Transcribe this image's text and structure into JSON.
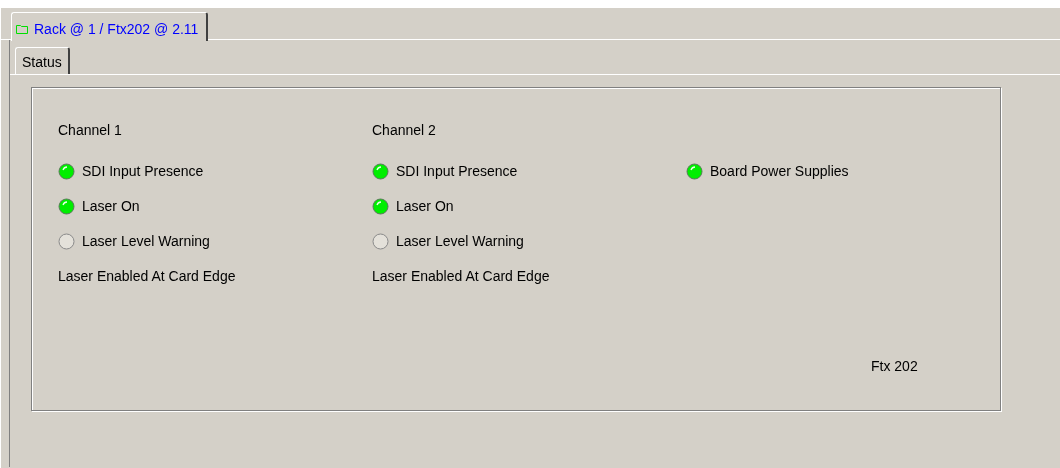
{
  "document_tabs": [
    {
      "label": "Rack @ 1 / Ftx202 @ 2.11",
      "selected": true
    }
  ],
  "page_tabs": [
    {
      "label": "Status",
      "selected": true
    }
  ],
  "columns": [
    {
      "title": "Channel 1",
      "items": [
        {
          "kind": "indicator",
          "label": "SDI Input Presence",
          "on": true
        },
        {
          "kind": "indicator",
          "label": "Laser On",
          "on": true
        },
        {
          "kind": "indicator",
          "label": "Laser Level Warning",
          "on": false
        },
        {
          "kind": "text",
          "label": "Laser Enabled At Card Edge"
        }
      ]
    },
    {
      "title": "Channel 2",
      "items": [
        {
          "kind": "indicator",
          "label": "SDI Input Presence",
          "on": true
        },
        {
          "kind": "indicator",
          "label": "Laser On",
          "on": true
        },
        {
          "kind": "indicator",
          "label": "Laser Level Warning",
          "on": false
        },
        {
          "kind": "text",
          "label": "Laser Enabled At Card Edge"
        }
      ]
    },
    {
      "items": [
        {
          "kind": "indicator",
          "label": "Board Power Supplies",
          "on": true
        }
      ]
    }
  ],
  "model_label": "Ftx 202"
}
